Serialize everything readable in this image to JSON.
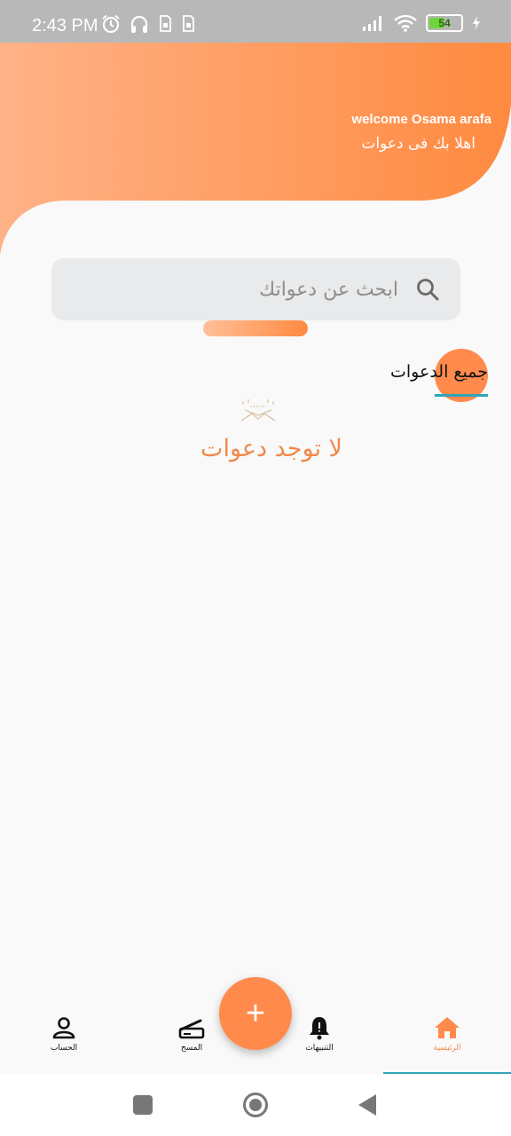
{
  "status_bar": {
    "time": "2:43 PM",
    "battery_level": "54",
    "battery_fraction": 0.54,
    "left_icons": [
      "alarm-icon",
      "headphones-icon",
      "sim-icon",
      "sim-icon"
    ],
    "right_icons": [
      "signal-icon",
      "wifi-icon",
      "battery-icon",
      "charging-icon"
    ]
  },
  "header": {
    "welcome_en": "welcome Osama arafa",
    "welcome_ar": "اهلا بك فى دعوات",
    "gradient": [
      "#ffb287",
      "#ff8a40"
    ]
  },
  "search": {
    "placeholder": "ابحث عن دعواتك"
  },
  "tabs": {
    "all_label": "جميع الدعوات"
  },
  "empty_state": {
    "message": "لا توجد دعوات"
  },
  "fab": {
    "label": "+"
  },
  "bottom_nav": {
    "items": [
      {
        "label": "الحساب",
        "icon": "account-icon"
      },
      {
        "label": "المسح",
        "icon": "scanner-icon"
      },
      {
        "label": "التنبيهات",
        "icon": "bell-icon"
      },
      {
        "label": "الرئيسية",
        "icon": "home-icon",
        "active": true
      }
    ]
  },
  "system_nav": {
    "buttons": [
      "recents-button",
      "home-button",
      "back-button"
    ]
  },
  "colors": {
    "accent": "#ff8a4c",
    "accent_text": "#f0894a",
    "tab_indicator": "#2fa5b7",
    "background": "#f9f9f9"
  }
}
